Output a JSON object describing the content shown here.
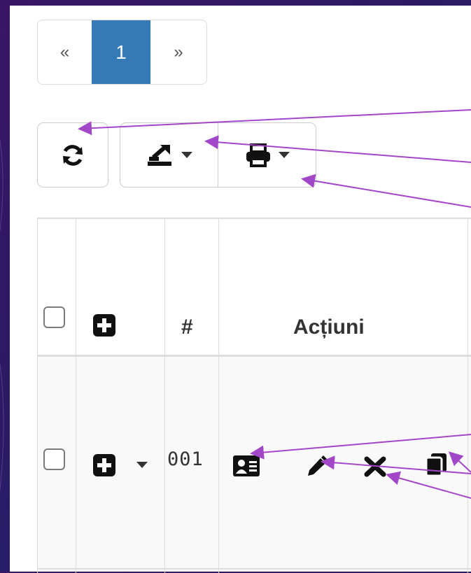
{
  "pagination": {
    "first": "«",
    "current": "1",
    "last": "»"
  },
  "toolbar": {
    "refresh_icon": "refresh-icon",
    "export_icon": "export-icon",
    "print_icon": "print-icon"
  },
  "table": {
    "header": {
      "hash": "#",
      "actions": "Acțiuni"
    },
    "rows": [
      {
        "number": "001",
        "actions": [
          "view-card-icon",
          "edit-pencil-icon",
          "delete-x-icon",
          "copy-icon"
        ]
      }
    ]
  },
  "colors": {
    "accent": "#337ab7",
    "annotation": "#a347c9",
    "background": "#2b1a63"
  }
}
